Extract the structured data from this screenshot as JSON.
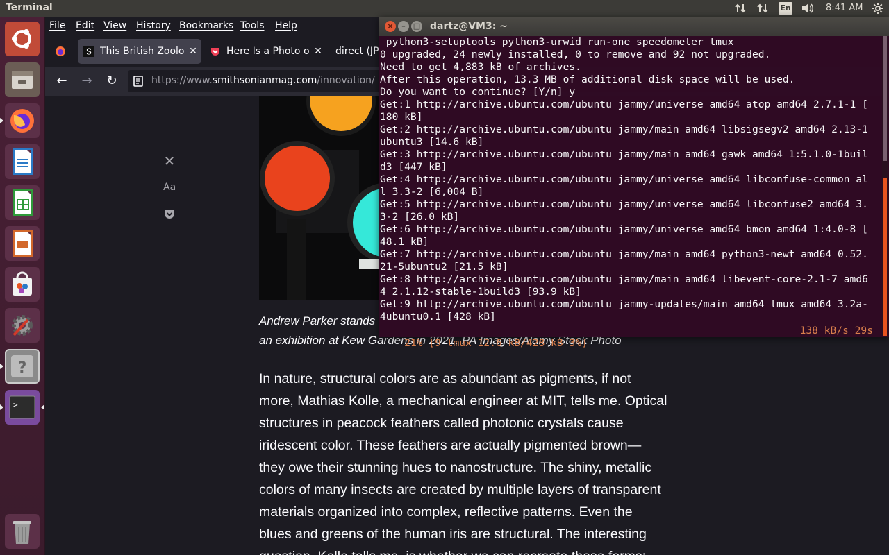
{
  "top_panel": {
    "app_title": "Terminal",
    "language": "En",
    "clock": "8:41 AM",
    "icons": [
      "network-up-down-icon",
      "network-transfer-icon",
      "keyboard-language-icon",
      "volume-icon",
      "settings-gear-icon"
    ]
  },
  "launcher": {
    "items": [
      "ubuntu-dash-icon",
      "files-icon",
      "firefox-icon",
      "writer-icon",
      "calc-icon",
      "impress-icon",
      "software-center-icon",
      "system-settings-icon",
      "help-icon",
      "terminal-icon",
      "trash-icon"
    ]
  },
  "browser": {
    "menu": [
      "File",
      "Edit",
      "View",
      "History",
      "Bookmarks",
      "Tools",
      "Help"
    ],
    "tabs": [
      {
        "title": "This British Zoologi",
        "favicon": "smithsonian-favicon"
      },
      {
        "title": "Here Is a Photo of",
        "favicon": "pocket-favicon"
      },
      {
        "title": "direct (JP",
        "favicon": "none"
      }
    ],
    "url_prefix": "https://www.",
    "url_domain": "smithsonianmag.com",
    "url_rest": "/innovation/"
  },
  "reader": {
    "font_label": "Aa"
  },
  "article": {
    "caption_line1": "Andrew Parker stands",
    "caption_line2": "an exhibition at Kew Gardens in 2021. PA Images/Alamy Stock Photo",
    "lines": [
      "In nature, structural colors are as abundant as pigments, if not",
      "more, Mathias Kolle, a mechanical engineer at MIT, tells me. Optical",
      "structures in peacock feathers called photonic crystals cause",
      "iridescent color. These feathers are actually pigmented brown—",
      "they owe their stunning hues to nanostructure. The shiny, metallic",
      "colors of many insects are created by multiple layers of transparent",
      "materials organized into complex, reflective patterns. Even the",
      "blues and greens of the human iris are structural. The interesting",
      "question, Kolle tells me, is whether we can recreate these forms:"
    ]
  },
  "terminal": {
    "title": "dartz@VM3: ~",
    "lines": [
      " python3-setuptools python3-urwid run-one speedometer tmux",
      "0 upgraded, 24 newly installed, 0 to remove and 92 not upgraded.",
      "Need to get 4,883 kB of archives.",
      "After this operation, 13.3 MB of additional disk space will be used.",
      "Do you want to continue? [Y/n] y",
      "Get:1 http://archive.ubuntu.com/ubuntu jammy/universe amd64 atop amd64 2.7.1-1 [",
      "180 kB]",
      "Get:2 http://archive.ubuntu.com/ubuntu jammy/main amd64 libsigsegv2 amd64 2.13-1",
      "ubuntu3 [14.6 kB]",
      "Get:3 http://archive.ubuntu.com/ubuntu jammy/main amd64 gawk amd64 1:5.1.0-1buil",
      "d3 [447 kB]",
      "Get:4 http://archive.ubuntu.com/ubuntu jammy/universe amd64 libconfuse-common al",
      "l 3.3-2 [6,004 B]",
      "Get:5 http://archive.ubuntu.com/ubuntu jammy/universe amd64 libconfuse2 amd64 3.",
      "3-2 [26.0 kB]",
      "Get:6 http://archive.ubuntu.com/ubuntu jammy/universe amd64 bmon amd64 1:4.0-8 [",
      "48.1 kB]",
      "Get:7 http://archive.ubuntu.com/ubuntu jammy/main amd64 python3-newt amd64 0.52.",
      "21-5ubuntu2 [21.5 kB]",
      "Get:8 http://archive.ubuntu.com/ubuntu jammy/main amd64 libevent-core-2.1-7 amd6",
      "4 2.1.12-stable-1build3 [93.9 kB]",
      "Get:9 http://archive.ubuntu.com/ubuntu jammy-updates/main amd64 tmux amd64 3.2a-",
      "4ubuntu0.1 [428 kB]"
    ],
    "status_left": "21% [9 tmux 12.6 kB/428 kB 3%]",
    "status_right": "138 kB/s 29s"
  },
  "colors": {
    "terminal_bg": "#300a24",
    "launcher_bg": "#4a2036",
    "browser_bg": "#1c1b22",
    "status_orange": "#e0834e"
  }
}
